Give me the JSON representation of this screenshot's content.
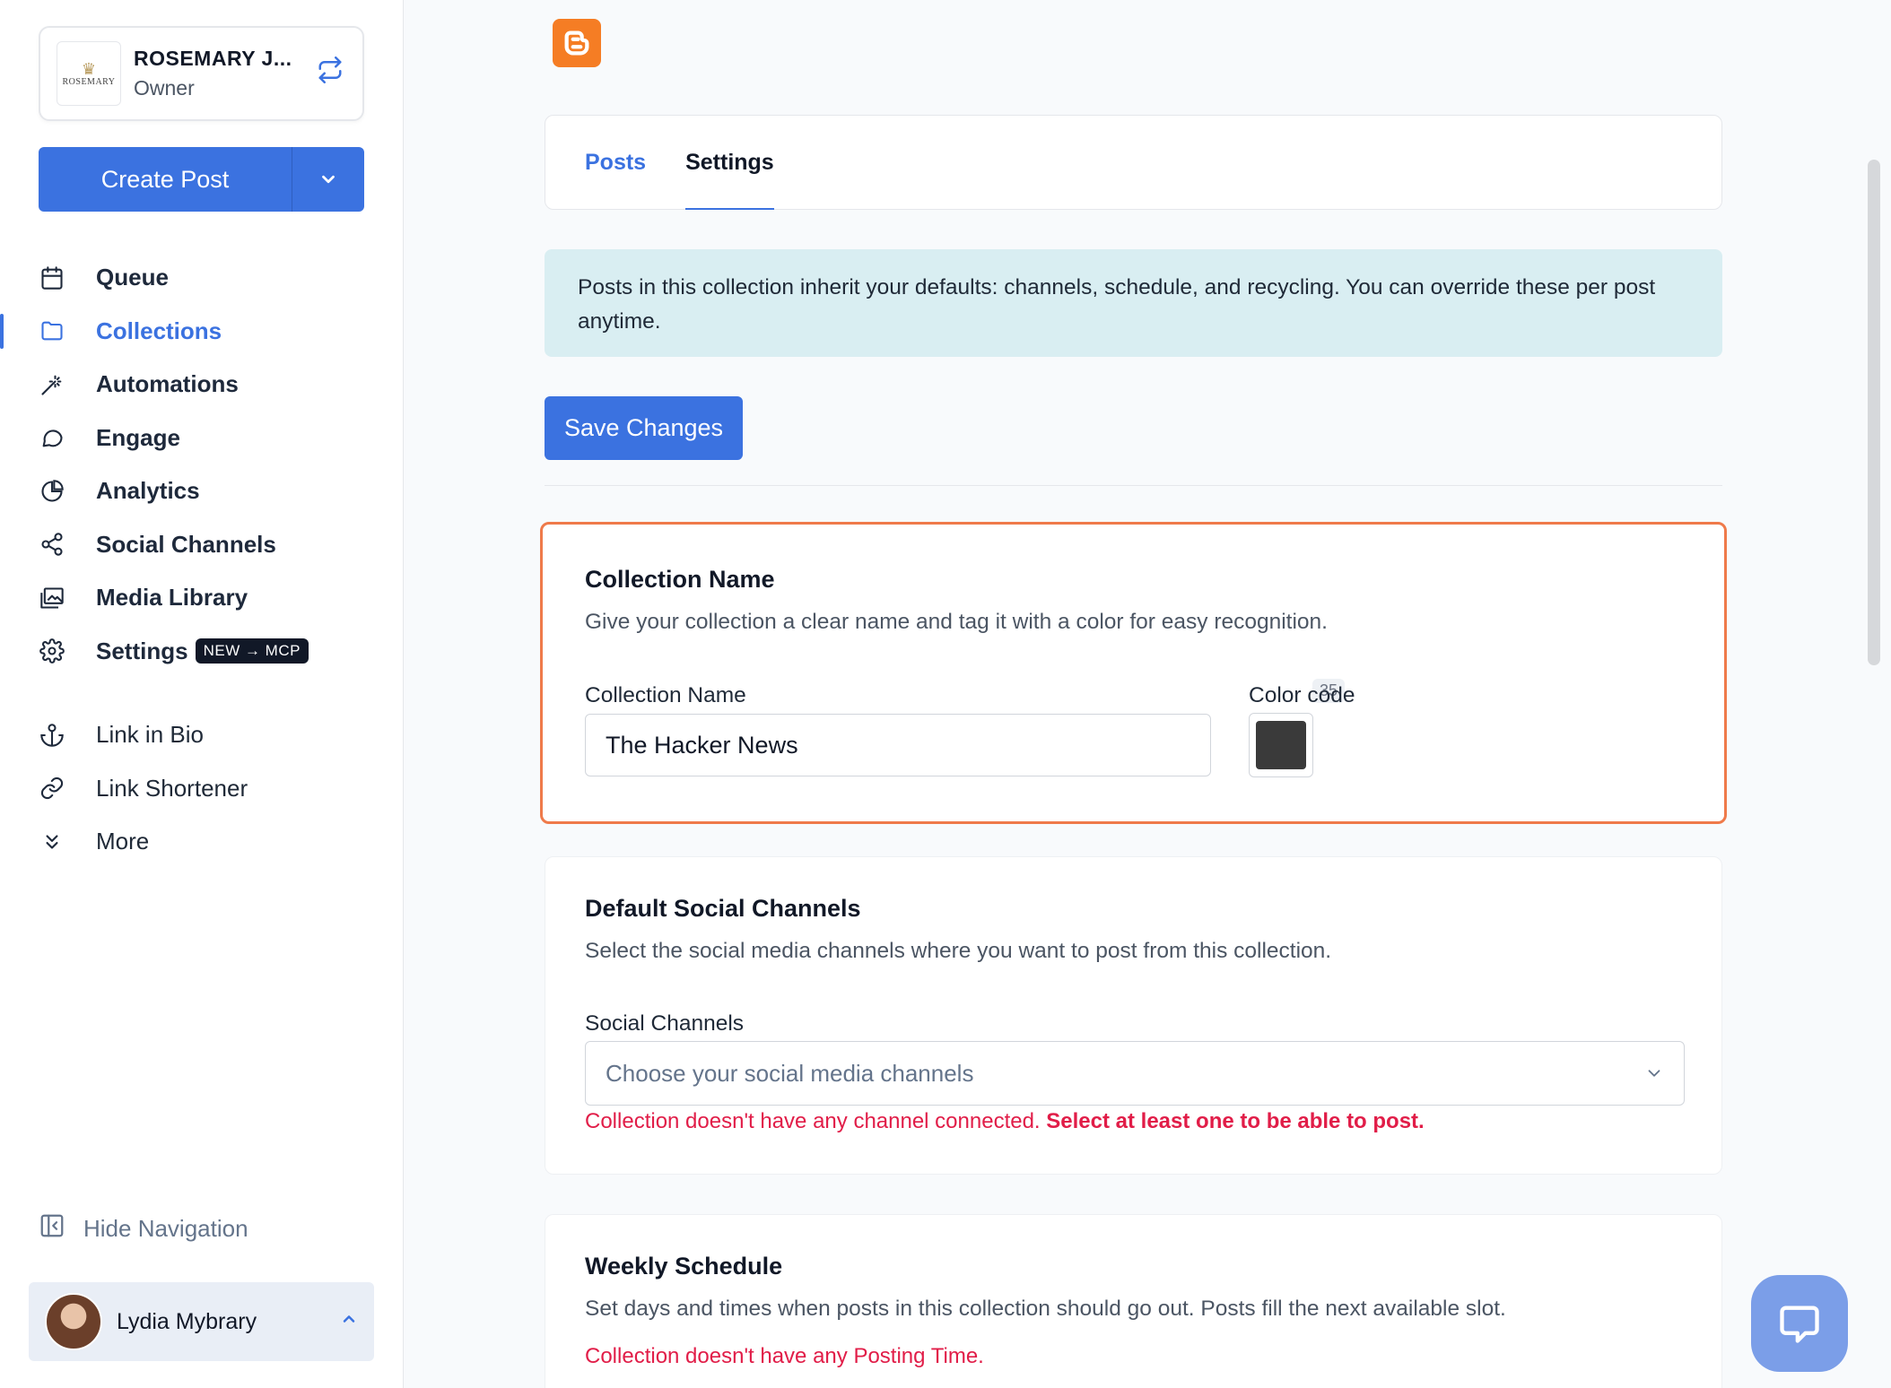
{
  "account": {
    "logo_text": "ROSEMARY",
    "name": "ROSEMARY J...",
    "role": "Owner"
  },
  "create_post": {
    "label": "Create Post"
  },
  "nav": {
    "items": [
      {
        "label": "Queue",
        "icon": "calendar-icon"
      },
      {
        "label": "Collections",
        "icon": "folder-icon",
        "active": true
      },
      {
        "label": "Automations",
        "icon": "magic-wand-icon"
      },
      {
        "label": "Engage",
        "icon": "chat-bubble-icon"
      },
      {
        "label": "Analytics",
        "icon": "pie-chart-icon"
      },
      {
        "label": "Social Channels",
        "icon": "share-icon"
      },
      {
        "label": "Media Library",
        "icon": "images-icon"
      },
      {
        "label": "Settings",
        "icon": "gear-icon",
        "badge": "NEW → MCP"
      }
    ],
    "secondary": [
      {
        "label": "Link in Bio",
        "icon": "anchor-icon"
      },
      {
        "label": "Link Shortener",
        "icon": "link-icon"
      },
      {
        "label": "More",
        "icon": "double-chevron-down-icon"
      }
    ]
  },
  "hide_navigation": {
    "label": "Hide Navigation"
  },
  "user": {
    "name": "Lydia Mybrary"
  },
  "tabs": [
    {
      "label": "Posts"
    },
    {
      "label": "Settings",
      "active": true
    }
  ],
  "info": {
    "text": "Posts in this collection inherit your defaults: channels, schedule, and recycling. You can override these per post anytime."
  },
  "save_button": {
    "label": "Save Changes"
  },
  "collection_name_card": {
    "title": "Collection Name",
    "description": "Give your collection a clear name and tag it with a color for easy recognition.",
    "name_label": "Collection Name",
    "name_value": "The Hacker News",
    "char_counter": "35",
    "color_label": "Color code",
    "color_value": "#3a3a3a"
  },
  "channels_card": {
    "title": "Default Social Channels",
    "description": "Select the social media channels where you want to post from this collection.",
    "field_label": "Social Channels",
    "placeholder": "Choose your social media channels",
    "error_text": "Collection doesn't have any channel connected.",
    "error_strong": "Select at least one to be able to post."
  },
  "schedule_card": {
    "title": "Weekly Schedule",
    "description": "Set days and times when posts in this collection should go out. Posts fill the next available slot.",
    "error_text": "Collection doesn't have any Posting Time."
  },
  "colors": {
    "accent": "#3b72e0",
    "blogger": "#f57d24",
    "highlight_border": "#ef7a4a",
    "error": "#e11d48",
    "info_bg": "#d9eef2"
  }
}
